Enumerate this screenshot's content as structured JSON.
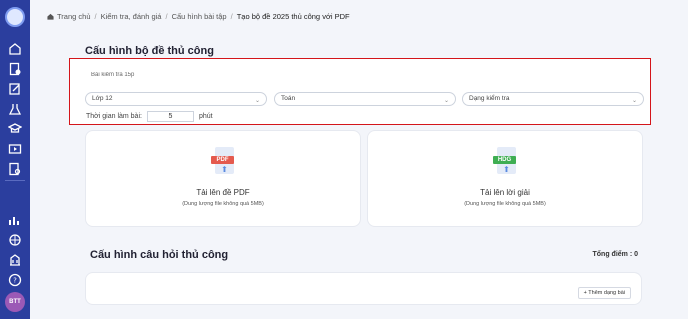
{
  "user": {
    "initials": "BTT"
  },
  "breadcrumb": [
    "Trang chủ",
    "Kiểm tra, đánh giá",
    "Cấu hình bài tập",
    "Tạo bộ đề 2025 thủ công với PDF"
  ],
  "config": {
    "title": "Cấu hình bộ đề thủ công",
    "name_value": "Bài kiểm tra 15p",
    "grade": "Lớp 12",
    "subject": "Toán",
    "type": "Dạng kiểm tra",
    "time_label": "Thời gian làm bài:",
    "time_value": "5",
    "time_unit": "phút"
  },
  "uploads": [
    {
      "badge": "PDF",
      "badge_color": "#e45a4e",
      "title": "Tải lên đề PDF",
      "subtitle": "(Dung lượng file không quá 5MB)"
    },
    {
      "badge": "HDG",
      "badge_color": "#3fae53",
      "title": "Tải lên lời giải",
      "subtitle": "(Dung lượng file không quá 5MB)"
    }
  ],
  "questions": {
    "title": "Cấu hình câu hỏi thủ công",
    "total_label": "Tổng điểm : 0",
    "add_button": "+ Thêm dạng bài"
  },
  "sidebar_icons": [
    "home-icon",
    "grade-icon",
    "edit-icon",
    "science-icon",
    "school-icon",
    "media-icon",
    "search-doc-icon",
    "chart-icon",
    "globe-icon",
    "building-icon",
    "help-icon"
  ]
}
